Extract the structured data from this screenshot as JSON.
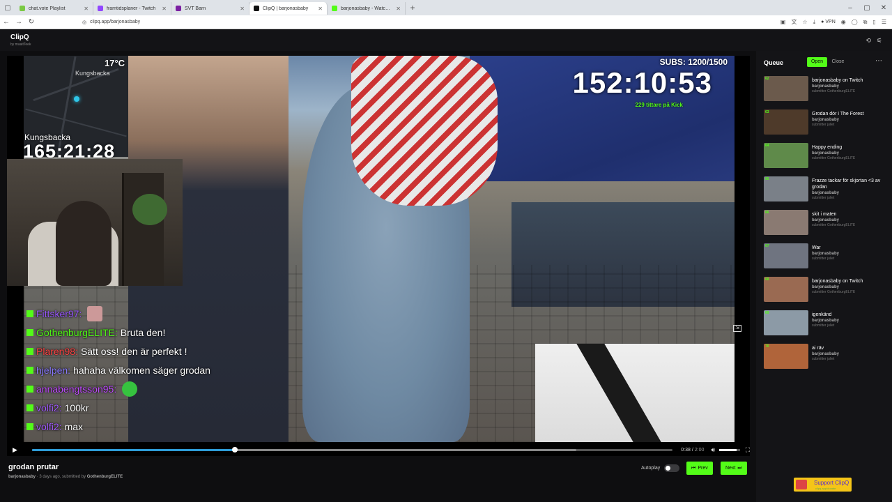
{
  "browser": {
    "tabs": [
      {
        "title": "chat.vote Playlist",
        "color": "#7ac943",
        "active": false
      },
      {
        "title": "framtidsplaner - Twitch",
        "color": "#9146ff",
        "active": false
      },
      {
        "title": "SVT Barn",
        "color": "#7b1fa2",
        "active": false
      },
      {
        "title": "ClipQ | barjonasbaby",
        "color": "#111111",
        "active": true
      },
      {
        "title": "barjonasbaby - Watch clips on K",
        "color": "#53fc18",
        "active": false
      }
    ],
    "url": "clipq.app/barjonasbaby",
    "vpn_label": "VPN"
  },
  "app": {
    "name": "ClipQ",
    "byline": "by maaitTeek"
  },
  "overlay": {
    "temperature": "17°C",
    "map_city": "Kungsbacka",
    "city": "Kungsbacka",
    "clock_small": "165:21:28",
    "subs": "SUBS: 1200/1500",
    "clock_big": "152:10:53",
    "kick_viewers": "229 tittare på Kick"
  },
  "chat": [
    {
      "user": "Fittsker97:",
      "color": "#9b59ff",
      "text": "",
      "emote": "face"
    },
    {
      "user": "GothenburgELITE:",
      "color": "#53fc18",
      "text": "Bruta den!",
      "emote": ""
    },
    {
      "user": "Plaren98:",
      "color": "#ff4545",
      "text": "Sätt oss! den är perfekt !",
      "emote": ""
    },
    {
      "user": "hjelpen:",
      "color": "#8a7bff",
      "text": "hahaha välkomen säger grodan",
      "emote": ""
    },
    {
      "user": "annabengtsson95:",
      "color": "#c04cff",
      "text": "",
      "emote": "green"
    },
    {
      "user": "volfi2:",
      "color": "#a35cff",
      "text": "100kr",
      "emote": ""
    },
    {
      "user": "volfi2:",
      "color": "#a35cff",
      "text": "max",
      "emote": ""
    }
  ],
  "player": {
    "current_time": "0:38",
    "duration": "2:00",
    "played_fraction": 0.317,
    "buffered_fraction": 0.85,
    "volume_fraction": 0.85
  },
  "clip": {
    "title": "grodan prutar",
    "channel": "barjonasbaby",
    "age": "3 days ago, submitted by",
    "submitter": "GothenburgELITE"
  },
  "controls": {
    "autoplay_label": "Autoplay",
    "prev_label": "Prev",
    "next_label": "Next"
  },
  "queue": {
    "title": "Queue",
    "open_label": "Open",
    "close_label": "Close",
    "items": [
      {
        "num": "62",
        "title": "barjonasbaby on Twitch",
        "channel": "barjonasbaby",
        "submitter": "submitter GothenburgELITE",
        "thumb": "#6b5a4c"
      },
      {
        "num": "63",
        "title": "Grodan dör i The Forest",
        "channel": "barjonasbaby",
        "submitter": "submitter juliet",
        "thumb": "#4e3a2a"
      },
      {
        "num": "64",
        "title": "Happy ending",
        "channel": "barjonasbaby",
        "submitter": "submitter GothenburgELITE",
        "thumb": "#5f8a4a"
      },
      {
        "num": "65",
        "title": "Frazze tackar för skjortan <3 av grodan",
        "channel": "barjonasbaby",
        "submitter": "submitter juliet",
        "thumb": "#7a8088"
      },
      {
        "num": "66",
        "title": "skit i maten",
        "channel": "barjonasbaby",
        "submitter": "submitter GothenburgELITE",
        "thumb": "#8a7a72"
      },
      {
        "num": "67",
        "title": "War",
        "channel": "barjonasbaby",
        "submitter": "submitter juliet",
        "thumb": "#6f7480"
      },
      {
        "num": "68",
        "title": "barjonasbaby on Twitch",
        "channel": "barjonasbaby",
        "submitter": "submitter GothenburgELITE",
        "thumb": "#9a6a52"
      },
      {
        "num": "69",
        "title": "igenkänd",
        "channel": "barjonasbaby",
        "submitter": "submitter juliet",
        "thumb": "#8c9aa6"
      },
      {
        "num": "70",
        "title": "ai räv",
        "channel": "barjonasbaby",
        "submitter": "submitter juliet",
        "thumb": "#b0643a"
      }
    ]
  },
  "support": {
    "label": "Support ClipQ",
    "sub": "clipq.app/donate"
  }
}
